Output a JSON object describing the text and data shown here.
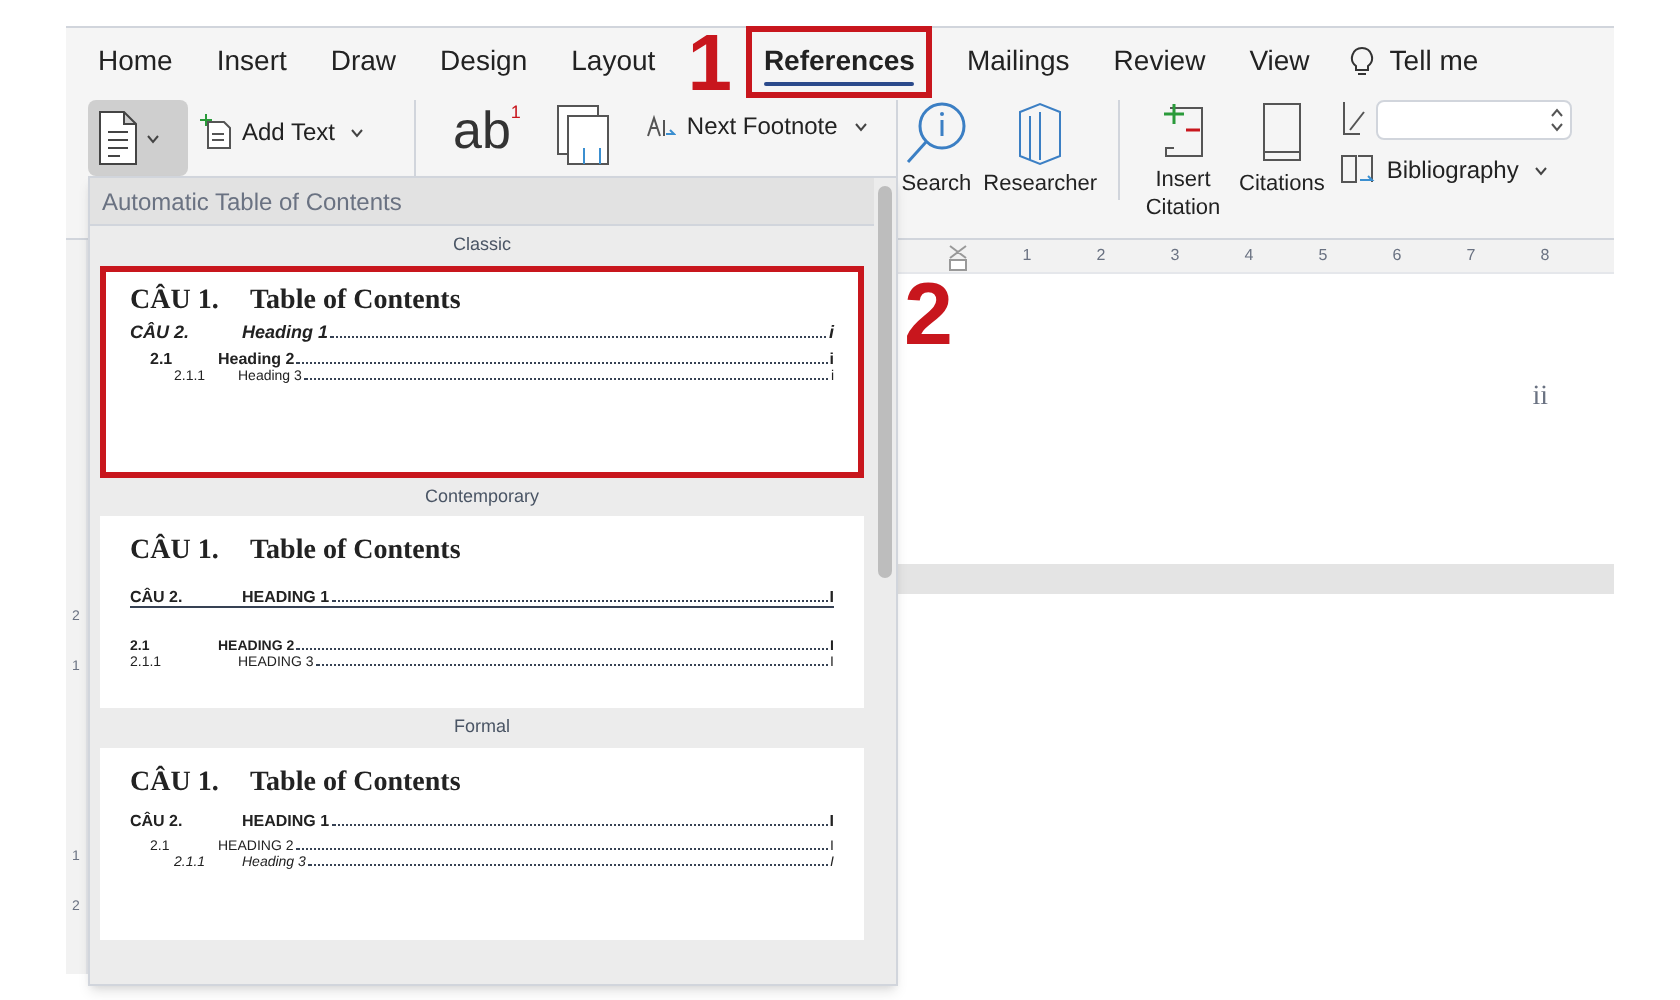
{
  "tabs": [
    {
      "label": "Home",
      "selected": false,
      "marked": false
    },
    {
      "label": "Insert",
      "selected": false,
      "marked": false
    },
    {
      "label": "Draw",
      "selected": false,
      "marked": false
    },
    {
      "label": "Design",
      "selected": false,
      "marked": false
    },
    {
      "label": "Layout",
      "selected": false,
      "marked": false
    },
    {
      "label": "References",
      "selected": true,
      "marked": true
    },
    {
      "label": "Mailings",
      "selected": false,
      "marked": false
    },
    {
      "label": "Review",
      "selected": false,
      "marked": false
    },
    {
      "label": "View",
      "selected": false,
      "marked": false
    }
  ],
  "tell_me": "Tell me",
  "ribbon": {
    "toc_expanded": true,
    "add_text": "Add Text",
    "footnote_glyph": "ab",
    "footnote_mark": "1",
    "next_footnote": "Next Footnote",
    "search": "Search",
    "researcher": "Researcher",
    "insert_citation": "Insert Citation",
    "citations": "Citations",
    "bibliography": "Bibliography"
  },
  "ruler": [
    "1",
    "2",
    "3",
    "4",
    "5",
    "6",
    "7",
    "8"
  ],
  "vertical_ruler": [
    "2",
    "1",
    "1",
    "2"
  ],
  "page_number": "ii",
  "toc_menu": {
    "header": "Automatic Table of Contents",
    "sections": [
      {
        "kind": "classic",
        "name": "Classic",
        "marked": true,
        "title_number": "CÂU 1.",
        "title": "Table of Contents",
        "entries": [
          {
            "number": "CÂU 2.",
            "text": "Heading 1",
            "page": "i",
            "children": [
              {
                "number": "2.1",
                "text": "Heading 2",
                "page": "i",
                "children": [
                  {
                    "number": "2.1.1",
                    "text": "Heading 3",
                    "page": "i"
                  }
                ]
              }
            ]
          }
        ]
      },
      {
        "kind": "contemporary",
        "name": "Contemporary",
        "marked": false,
        "title_number": "CÂU 1.",
        "title": "Table of Contents",
        "entries": [
          {
            "number": "CÂU 2.",
            "text": "HEADING 1",
            "page": "I",
            "children": [
              {
                "number": "2.1",
                "text": "HEADING 2",
                "page": "I",
                "children": [
                  {
                    "number": "2.1.1",
                    "text": "HEADING 3",
                    "page": "I"
                  }
                ]
              }
            ]
          }
        ]
      },
      {
        "kind": "formal",
        "name": "Formal",
        "marked": false,
        "title_number": "CÂU 1.",
        "title": "Table of Contents",
        "entries": [
          {
            "number": "CÂU 2.",
            "text": "HEADING 1",
            "page": "I",
            "children": [
              {
                "number": "2.1",
                "text": "HEADING 2",
                "page": "I",
                "children": [
                  {
                    "number": "2.1.1",
                    "text": "Heading 3",
                    "page": "I"
                  }
                ]
              }
            ]
          }
        ]
      }
    ]
  },
  "annotations": [
    {
      "label": "1"
    },
    {
      "label": "2"
    }
  ]
}
